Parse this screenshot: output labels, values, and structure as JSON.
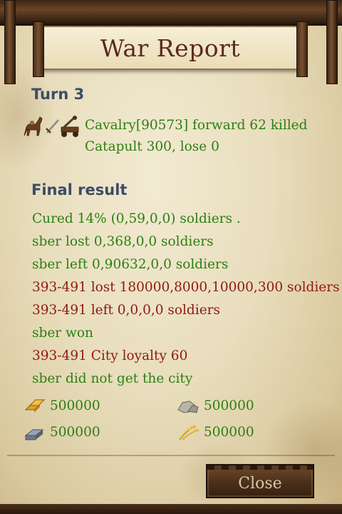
{
  "title": "War Report",
  "turn": {
    "heading": "Turn 3",
    "icons": [
      "horse-icon",
      "sword-icon",
      "catapult-icon"
    ],
    "lines": [
      "Cavalry[90573] forward 62 killed",
      "Catapult 300, lose 0"
    ]
  },
  "final": {
    "heading": "Final result",
    "lines": [
      {
        "text": "Cured 14% (0,59,0,0) soldiers .",
        "color": "#2b7f12"
      },
      {
        "text": "sber lost 0,368,0,0 soldiers",
        "color": "#2b7f12"
      },
      {
        "text": "sber left 0,90632,0,0 soldiers",
        "color": "#2b7f12"
      },
      {
        "text": "393-491 lost 180000,8000,10000,300 soldiers",
        "color": "#8f1a10"
      },
      {
        "text": "393-491 left 0,0,0,0 soldiers",
        "color": "#8f1a10"
      },
      {
        "text": "sber won",
        "color": "#2b7f12"
      },
      {
        "text": "393-491 City loyalty 60",
        "color": "#8f1a10"
      },
      {
        "text": "sber did not get the city",
        "color": "#2b7f12"
      }
    ]
  },
  "resources": [
    {
      "icon": "gold-icon",
      "value": "500000"
    },
    {
      "icon": "stone-icon",
      "value": "500000"
    },
    {
      "icon": "iron-icon",
      "value": "500000"
    },
    {
      "icon": "food-icon",
      "value": "500000"
    }
  ],
  "close_label": "Close"
}
